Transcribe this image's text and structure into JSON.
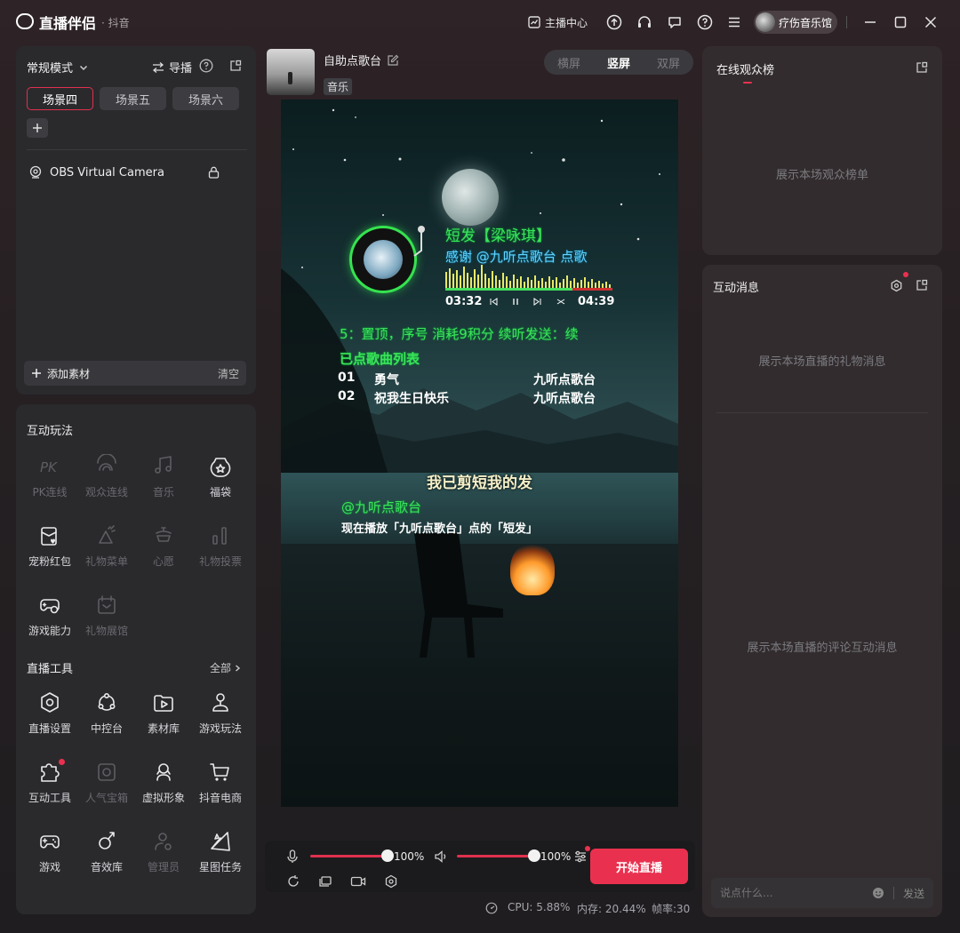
{
  "app": {
    "name": "直播伴侣",
    "sub": "· 抖音"
  },
  "titlebar": {
    "anchor_center": "主播中心",
    "user_name": "疗伤音乐馆"
  },
  "scenes": {
    "mode": "常规模式",
    "guide": "导播",
    "tabs": [
      "场景四",
      "场景五",
      "场景六"
    ],
    "active_tab": 0,
    "sources": [
      {
        "name": "OBS Virtual Camera"
      }
    ],
    "add_material": "添加素材",
    "clear": "清空"
  },
  "interactive": {
    "title": "互动玩法",
    "items": [
      {
        "label": "PK连线",
        "icon": "pk-icon",
        "enabled": false
      },
      {
        "label": "观众连线",
        "icon": "audience-link-icon",
        "enabled": false
      },
      {
        "label": "音乐",
        "icon": "music-note-icon",
        "enabled": false
      },
      {
        "label": "福袋",
        "icon": "lucky-bag-icon",
        "enabled": true
      },
      {
        "label": "宠粉红包",
        "icon": "red-packet-icon",
        "enabled": true
      },
      {
        "label": "礼物菜单",
        "icon": "gift-menu-icon",
        "enabled": false
      },
      {
        "label": "心愿",
        "icon": "wish-icon",
        "enabled": false
      },
      {
        "label": "礼物投票",
        "icon": "gift-vote-icon",
        "enabled": false
      },
      {
        "label": "游戏能力",
        "icon": "game-ability-icon",
        "enabled": true
      },
      {
        "label": "礼物展馆",
        "icon": "gift-hall-icon",
        "enabled": false
      }
    ]
  },
  "tools": {
    "title": "直播工具",
    "all": "全部",
    "items": [
      {
        "label": "直播设置",
        "icon": "live-settings-icon",
        "enabled": true
      },
      {
        "label": "中控台",
        "icon": "control-center-icon",
        "enabled": true
      },
      {
        "label": "素材库",
        "icon": "material-library-icon",
        "enabled": true
      },
      {
        "label": "游戏玩法",
        "icon": "game-play-icon",
        "enabled": true
      },
      {
        "label": "互动工具",
        "icon": "interactive-tools-icon",
        "enabled": true,
        "dot": true
      },
      {
        "label": "人气宝箱",
        "icon": "popularity-box-icon",
        "enabled": false
      },
      {
        "label": "虚拟形象",
        "icon": "avatar-icon",
        "enabled": true
      },
      {
        "label": "抖音电商",
        "icon": "shopping-cart-icon",
        "enabled": true
      },
      {
        "label": "游戏",
        "icon": "gamepad-icon",
        "enabled": true
      },
      {
        "label": "音效库",
        "icon": "sound-effects-icon",
        "enabled": true
      },
      {
        "label": "管理员",
        "icon": "admin-icon",
        "enabled": false
      },
      {
        "label": "星图任务",
        "icon": "star-task-icon",
        "enabled": true
      }
    ]
  },
  "stream": {
    "title": "自助点歌台",
    "category": "音乐",
    "orientations": [
      "横屏",
      "竖屏",
      "双屏"
    ],
    "active_orientation": 1
  },
  "overlay": {
    "song": "短发【梁咏琪】",
    "thanks": "感谢 @九听点歌台 点歌",
    "time_current": "03:32",
    "time_total": "04:39",
    "progress": 0.76,
    "ticker": "5：置顶，序号  消耗9积分  续听发送：续",
    "queue_title": "已点歌曲列表",
    "queue": [
      {
        "no": "01",
        "name": "勇气",
        "by": "九听点歌台"
      },
      {
        "no": "02",
        "name": "祝我生日快乐",
        "by": "九听点歌台"
      }
    ],
    "lyric": "我已剪短我的发",
    "requester": "@九听点歌台",
    "now_playing": "现在播放「九听点歌台」点的「短发」"
  },
  "controls": {
    "mic_volume": "100%",
    "mic_level": 1.0,
    "speaker_volume": "100%",
    "speaker_level": 1.0,
    "start_live": "开始直播"
  },
  "status": {
    "cpu": "CPU: 5.88%",
    "memory": "内存: 20.44%",
    "fps": "帧率:30"
  },
  "rank": {
    "title": "在线观众榜",
    "empty": "展示本场观众榜单"
  },
  "messages": {
    "title": "互动消息",
    "gift_empty": "展示本场直播的礼物消息",
    "comment_empty": "展示本场直播的评论互动消息",
    "input_placeholder": "说点什么...",
    "send": "发送"
  },
  "colors": {
    "accent": "#e9314f",
    "overlay_green": "#3ce35a",
    "overlay_blue": "#5fd4ff"
  }
}
